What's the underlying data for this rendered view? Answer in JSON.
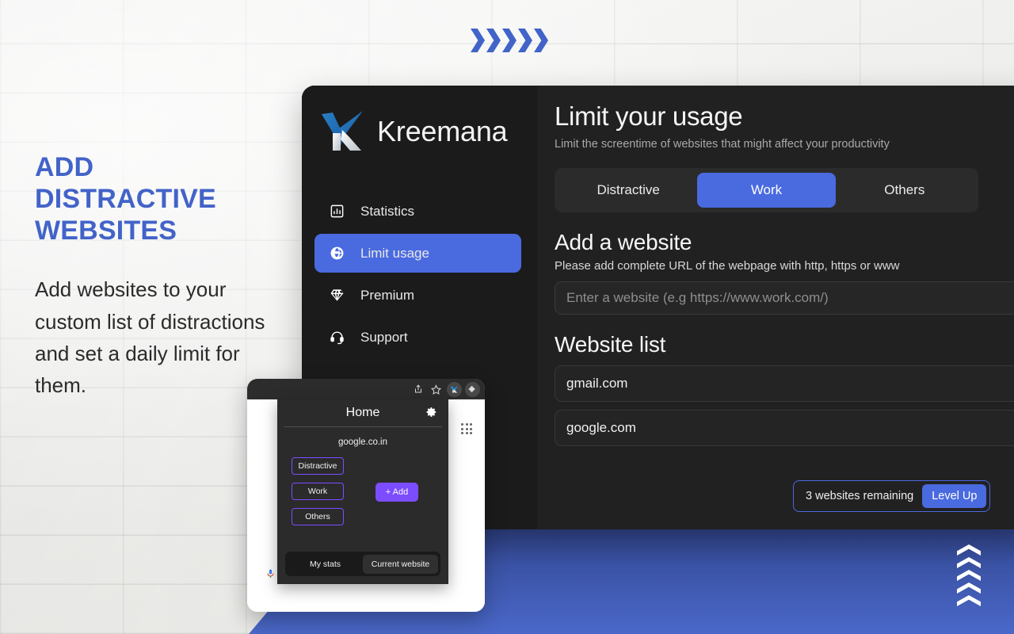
{
  "marketing": {
    "heading": "ADD DISTRACTIVE WEBSITES",
    "body": "Add websites to your custom list of distractions and set a daily limit for them.",
    "accent_color": "#4263c8",
    "top_chevron_count": 5,
    "bottom_chevron_count": 5
  },
  "app": {
    "brand": {
      "name": "Kreemana",
      "logo_icon": "kreemana-k-logo"
    },
    "sidebar": {
      "items": [
        {
          "label": "Statistics",
          "icon": "bar-chart-icon",
          "active": false
        },
        {
          "label": "Limit usage",
          "icon": "globe-icon",
          "active": true
        },
        {
          "label": "Premium",
          "icon": "diamond-icon",
          "active": false
        },
        {
          "label": "Support",
          "icon": "headset-icon",
          "active": false
        }
      ]
    },
    "main": {
      "title": "Limit your usage",
      "subtitle": "Limit the screentime of websites that might affect your productivity",
      "tabs": [
        {
          "label": "Distractive",
          "active": false
        },
        {
          "label": "Work",
          "active": true
        },
        {
          "label": "Others",
          "active": false
        }
      ],
      "add_website": {
        "title": "Add a website",
        "hint": "Please add complete URL of the webpage with http, https or www",
        "input_value": "",
        "input_placeholder": "Enter a website (e.g https://www.work.com/)"
      },
      "website_list": {
        "title": "Website list",
        "items": [
          "gmail.com",
          "google.com"
        ]
      },
      "level_up": {
        "remaining_text": "3 websites remaining",
        "button_label": "Level Up"
      }
    },
    "accent_color": "#4a6ae0",
    "surface_color": "#212121",
    "sidebar_color": "#1b1b1b"
  },
  "browser_mockup": {
    "toolbar_icons": [
      "share-icon",
      "star-icon",
      "kreemana-extension-icon",
      "puzzle-piece-icon"
    ],
    "page_icons": [
      "microphone-icon",
      "apps-grid-icon"
    ],
    "popup": {
      "title": "Home",
      "settings_icon": "gear-icon",
      "current_url": "google.co.in",
      "categories": [
        "Distractive",
        "Work",
        "Others"
      ],
      "add_button_label": "+ Add",
      "add_button_color": "#7c4dff",
      "footer_tabs": [
        {
          "label": "My stats",
          "active": false
        },
        {
          "label": "Current website",
          "active": true
        }
      ]
    }
  }
}
